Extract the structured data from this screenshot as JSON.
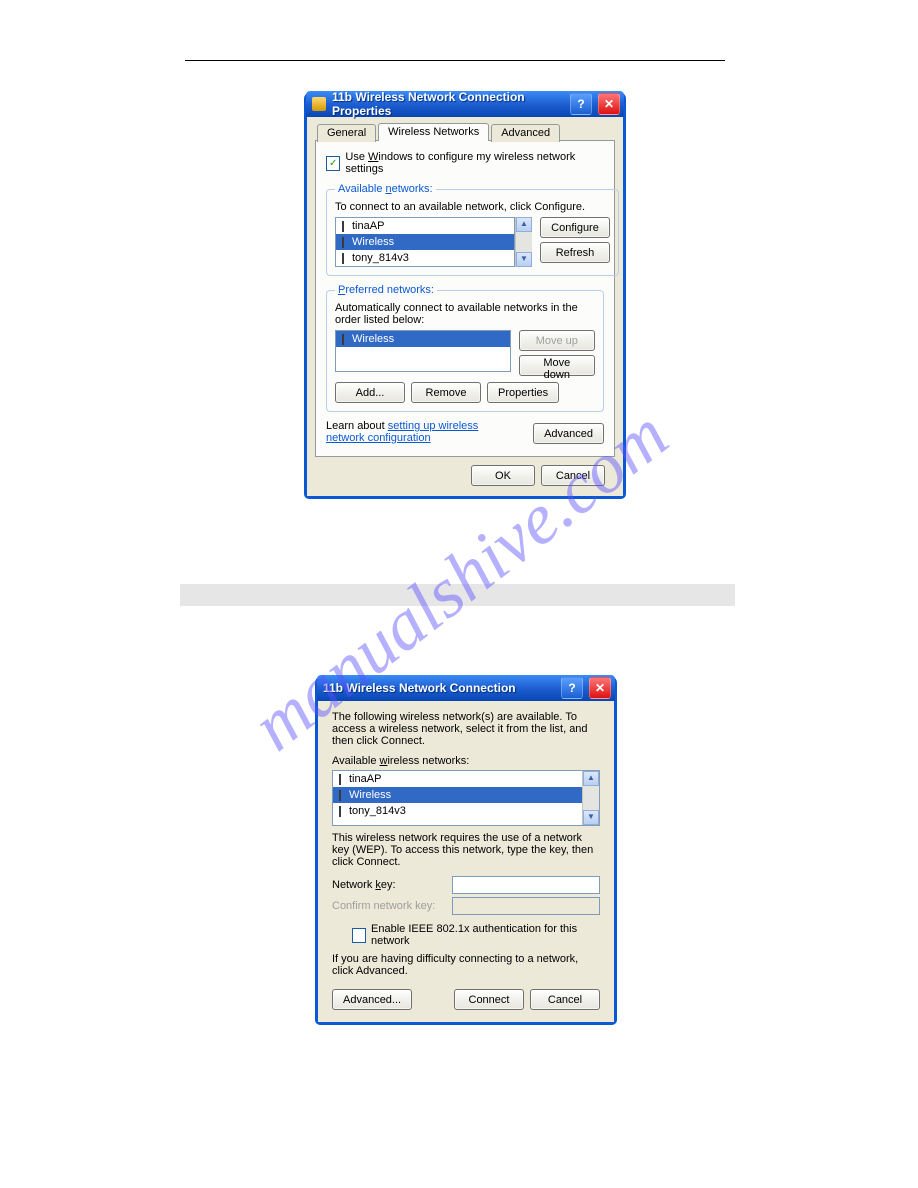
{
  "watermark": "manualshive.com",
  "dialog1": {
    "title": "11b Wireless Network Connection Properties",
    "tabs": {
      "general": "General",
      "wireless": "Wireless Networks",
      "advanced": "Advanced"
    },
    "use_windows_cb": "Use Windows to configure my wireless network settings",
    "use_windows_cb_checked": true,
    "available": {
      "legend": "Available networks:",
      "hint": "To connect to an available network, click Configure.",
      "items": [
        "tinaAP",
        "Wireless",
        "tony_814v3"
      ],
      "selected_index": 1,
      "configure_btn": "Configure",
      "refresh_btn": "Refresh"
    },
    "preferred": {
      "legend": "Preferred networks:",
      "hint": "Automatically connect to available networks in the order listed below:",
      "items": [
        "Wireless"
      ],
      "moveup_btn": "Move up",
      "movedown_btn": "Move down",
      "add_btn": "Add...",
      "remove_btn": "Remove",
      "properties_btn": "Properties"
    },
    "learn_text": "Learn about ",
    "learn_link": "setting up wireless network configuration",
    "advanced_btn": "Advanced",
    "ok_btn": "OK",
    "cancel_btn": "Cancel"
  },
  "dialog2": {
    "title": "11b Wireless Network Connection",
    "intro": "The following wireless network(s) are available. To access a wireless network, select it from the list, and then click Connect.",
    "list_label": "Available wireless networks:",
    "items": [
      "tinaAP",
      "Wireless",
      "tony_814v3"
    ],
    "selected_index": 1,
    "wep_text": "This wireless network requires the use of a network key (WEP). To access this network, type the key, then click Connect.",
    "netkey_label": "Network key:",
    "confirm_label": "Confirm network key:",
    "ieee_cb": "Enable IEEE 802.1x authentication for this network",
    "ieee_cb_checked": false,
    "difficulty_text": "If you are having difficulty connecting to a network, click Advanced.",
    "advanced_btn": "Advanced...",
    "connect_btn": "Connect",
    "cancel_btn": "Cancel"
  }
}
